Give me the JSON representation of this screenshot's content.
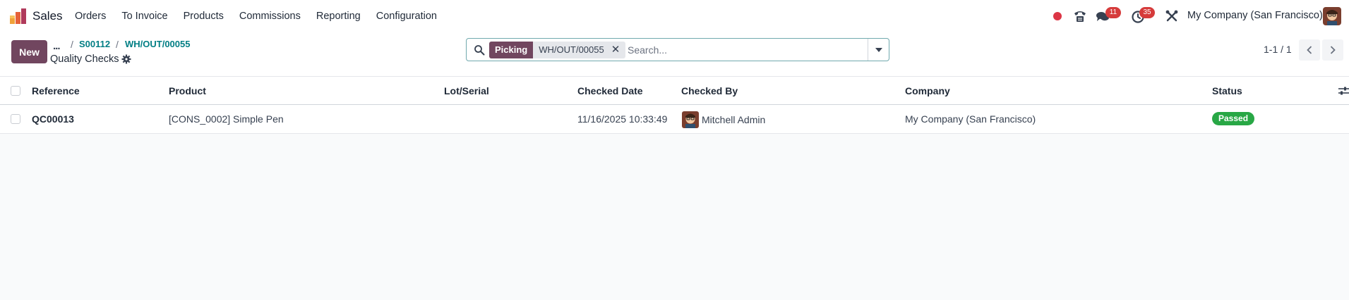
{
  "app": {
    "name": "Sales",
    "icon": "sales-app-icon"
  },
  "menu": {
    "items": [
      "Orders",
      "To Invoice",
      "Products",
      "Commissions",
      "Reporting",
      "Configuration"
    ]
  },
  "systray": {
    "recording_color": "#dc3545",
    "messages_count": "11",
    "activities_count": "35",
    "company": "My Company (San Francisco)"
  },
  "breadcrumb": {
    "ellipsis": "...",
    "items": [
      "S00112",
      "WH/OUT/00055"
    ]
  },
  "page": {
    "title": "Quality Checks",
    "new_label": "New"
  },
  "search": {
    "facet_label": "Picking",
    "facet_value": "WH/OUT/00055",
    "placeholder": "Search..."
  },
  "pager": {
    "value": "1-1 / 1"
  },
  "table": {
    "columns": [
      "Reference",
      "Product",
      "Lot/Serial",
      "Checked Date",
      "Checked By",
      "Company",
      "Status"
    ],
    "rows": [
      {
        "reference": "QC00013",
        "product": "[CONS_0002] Simple Pen",
        "lot": "",
        "checked_date": "11/16/2025 10:33:49",
        "checked_by": "Mitchell Admin",
        "company": "My Company (San Francisco)",
        "status": "Passed"
      }
    ]
  },
  "colors": {
    "primary": "#71465f",
    "link": "#017e84",
    "success": "#28a745",
    "badge": "#d63b3b"
  }
}
